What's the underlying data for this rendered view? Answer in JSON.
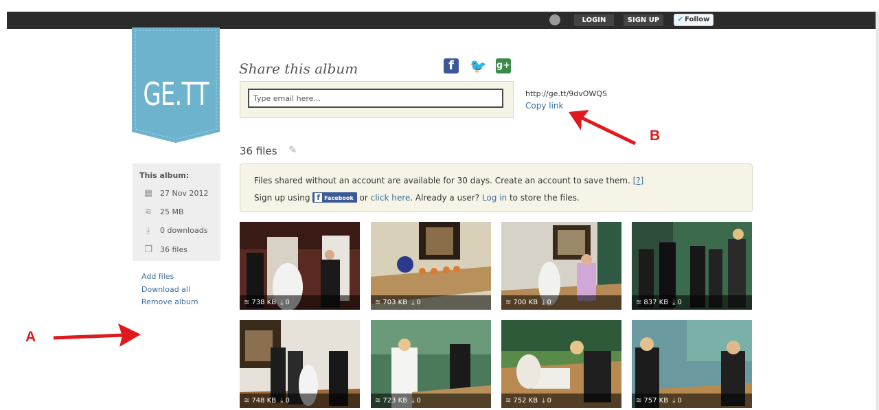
{
  "topbar": {
    "login_label": "LOGIN",
    "signup_label": "SIGN UP",
    "follow_label": "Follow"
  },
  "logo": {
    "text": "GE.TT",
    "color": "#6db3ce"
  },
  "share": {
    "title": "Share this album",
    "email_placeholder": "Type email here...",
    "url": "http://ge.tt/9dvOWQS",
    "copy_link_label": "Copy link"
  },
  "files": {
    "count_label": "36 files"
  },
  "notice": {
    "line1": "Files shared without an account are available for 30 days. Create an account to save them.",
    "help_label": "[?]",
    "signup_prefix": "Sign up using",
    "facebook_label": "Facebook",
    "or_text": "or",
    "click_here_label": "click here",
    "already_text": ". Already a user?",
    "login_label": "Log in",
    "store_text": "to store the files."
  },
  "album": {
    "heading": "This album:",
    "date": "27 Nov 2012",
    "size": "25 MB",
    "downloads": "0 downloads",
    "files": "36 files"
  },
  "side_links": {
    "add_files": "Add files",
    "download_all": "Download all",
    "remove_album": "Remove album"
  },
  "thumbnails": [
    {
      "size": "738 KB",
      "downloads": "0"
    },
    {
      "size": "703 KB",
      "downloads": "0"
    },
    {
      "size": "700 KB",
      "downloads": "0"
    },
    {
      "size": "837 KB",
      "downloads": "0"
    },
    {
      "size": "748 KB",
      "downloads": "0"
    },
    {
      "size": "723 KB",
      "downloads": "0"
    },
    {
      "size": "752 KB",
      "downloads": "0"
    },
    {
      "size": "757 KB",
      "downloads": "0"
    }
  ],
  "annotations": {
    "a_label": "A",
    "b_label": "B",
    "color": "#e0191e"
  }
}
